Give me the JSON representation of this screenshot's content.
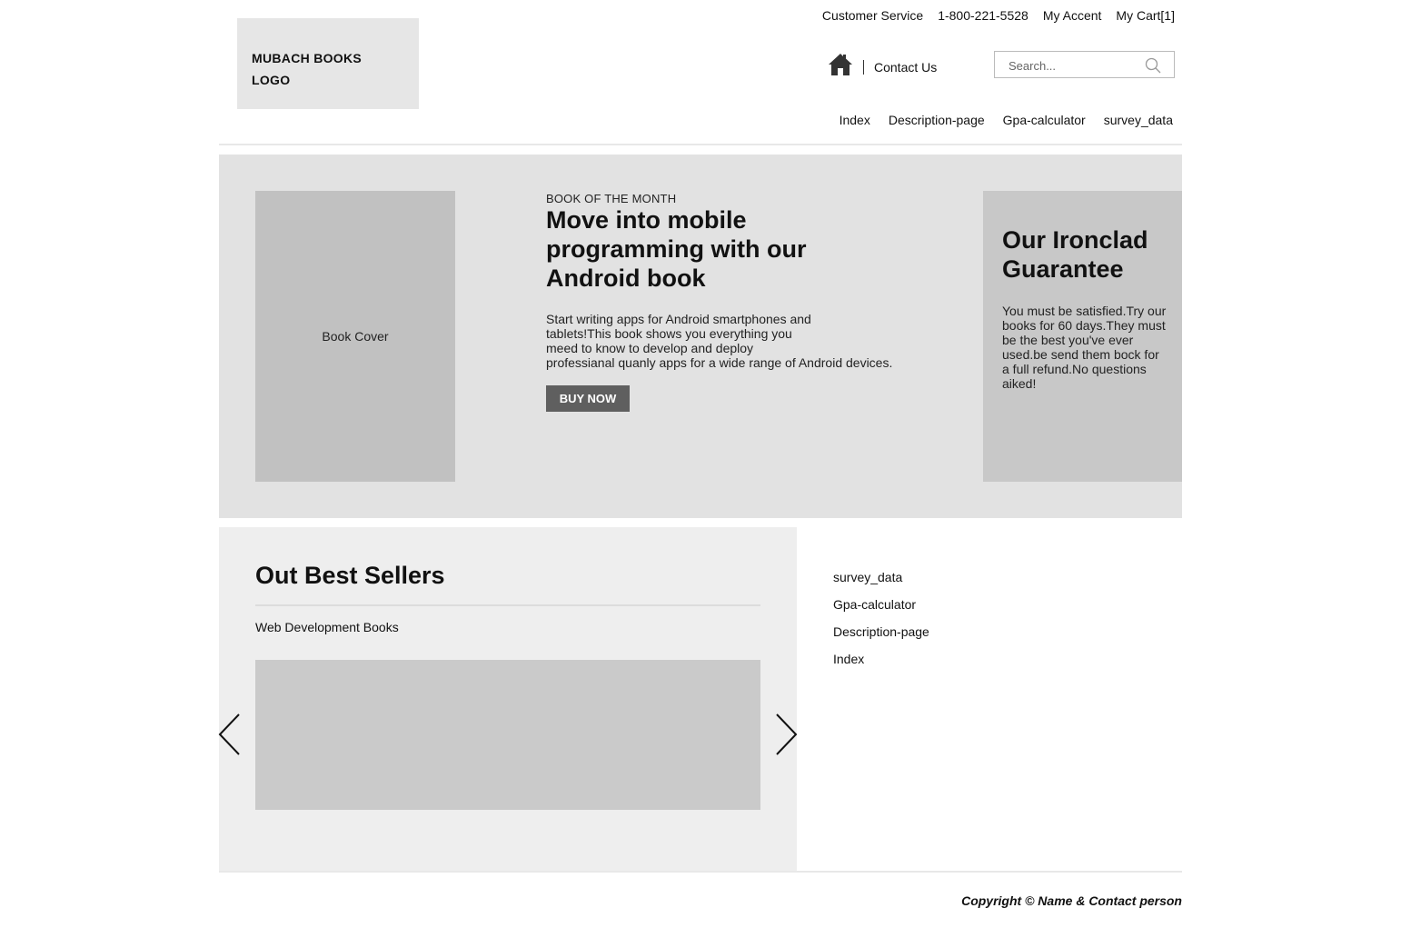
{
  "header": {
    "logo_line1": "MUBACH BOOKS",
    "logo_line2": "LOGO",
    "top_links": [
      "Customer Service",
      "1-800-221-5528",
      "My Accent",
      "My Cart[1]"
    ],
    "home_icon": "home-icon",
    "contact_label": "Contact Us",
    "search_placeholder": "Search...",
    "search_icon": "search-icon",
    "nav": [
      "Index",
      "Description-page",
      "Gpa-calculator",
      "survey_data"
    ]
  },
  "hero": {
    "cover_label": "Book Cover",
    "kicker": "BOOK OF THE MONTH",
    "headline": "Move into mobile programming with our Android book",
    "description_lines": [
      "Start writing apps for Android smartphones and",
      "tablets!This book shows you everything you",
      "meed to know to develop and deploy",
      "professianal quanly apps for a wide range of Android devices."
    ],
    "buy_label": "BUY NOW",
    "guarantee_title": "Our Ironclad Guarantee",
    "guarantee_text": "You must be satisfied.Try our books for 60 days.They must be the best you've ever used.be send them bock for a full refund.No questions aiked!"
  },
  "best_sellers": {
    "title": "Out Best Sellers",
    "subtitle": "Web Development Books",
    "prev_icon": "chevron-left-icon",
    "next_icon": "chevron-right-icon"
  },
  "sidebar_links": [
    "survey_data",
    "Gpa-calculator",
    "Description-page",
    "Index"
  ],
  "footer": {
    "copyright": "Copyright © Name & Contact person"
  },
  "colors": {
    "hero_bg": "#e2e2e2",
    "cover_bg": "#c1c1c1",
    "guarantee_bg": "#c8c8c8",
    "bestsellers_bg": "#eeeeee",
    "carousel_bg": "#cacaca",
    "button_bg": "#5f5f5f"
  }
}
